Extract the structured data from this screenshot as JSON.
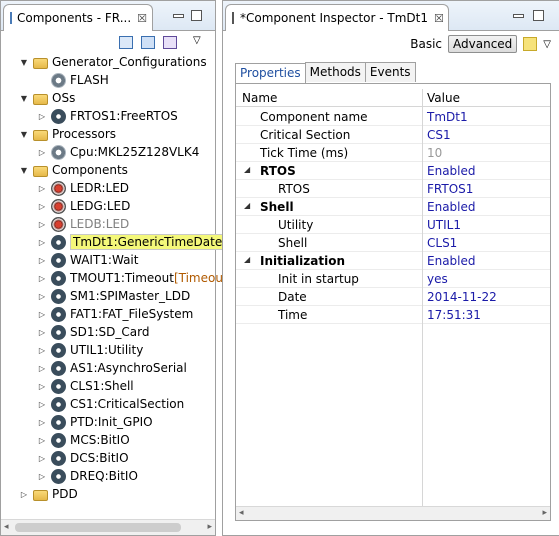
{
  "left_panel": {
    "tab_title": "Components - FR...",
    "close": "☒",
    "tree": [
      {
        "label": "Generator_Configurations",
        "indent": 0,
        "twisty": "▼",
        "icon": "folder-icon"
      },
      {
        "label": "FLASH",
        "indent": 1,
        "twisty": "",
        "icon": "gear-icon"
      },
      {
        "label": "OSs",
        "indent": 0,
        "twisty": "▼",
        "icon": "folder-icon"
      },
      {
        "label": "FRTOS1:FreeRTOS",
        "indent": 1,
        "twisty": "▷",
        "icon": "component-icon"
      },
      {
        "label": "Processors",
        "indent": 0,
        "twisty": "▼",
        "icon": "folder-icon"
      },
      {
        "label": "Cpu:MKL25Z128VLK4",
        "indent": 1,
        "twisty": "▷",
        "icon": "cpu-icon"
      },
      {
        "label": "Components",
        "indent": 0,
        "twisty": "▼",
        "icon": "folder-icon"
      },
      {
        "label": "LEDR:LED",
        "indent": 1,
        "twisty": "▷",
        "icon": "led-icon"
      },
      {
        "label": "LEDG:LED",
        "indent": 1,
        "twisty": "▷",
        "icon": "led-icon"
      },
      {
        "label": "LEDB:LED",
        "indent": 1,
        "twisty": "▷",
        "icon": "led-icon"
      },
      {
        "label": "TmDt1:GenericTimeDate",
        "indent": 1,
        "twisty": "▷",
        "icon": "component-icon",
        "selected": true
      },
      {
        "label": "WAIT1:Wait",
        "indent": 1,
        "twisty": "▷",
        "icon": "component-icon"
      },
      {
        "label": "TMOUT1:Timeout",
        "label_suffix": "[Timeou",
        "indent": 1,
        "twisty": "▷",
        "icon": "component-icon"
      },
      {
        "label": "SM1:SPIMaster_LDD",
        "indent": 1,
        "twisty": "▷",
        "icon": "component-icon"
      },
      {
        "label": "FAT1:FAT_FileSystem",
        "indent": 1,
        "twisty": "▷",
        "icon": "component-icon"
      },
      {
        "label": "SD1:SD_Card",
        "indent": 1,
        "twisty": "▷",
        "icon": "component-icon"
      },
      {
        "label": "UTIL1:Utility",
        "indent": 1,
        "twisty": "▷",
        "icon": "component-icon"
      },
      {
        "label": "AS1:AsynchroSerial",
        "indent": 1,
        "twisty": "▷",
        "icon": "component-icon"
      },
      {
        "label": "CLS1:Shell",
        "indent": 1,
        "twisty": "▷",
        "icon": "component-icon"
      },
      {
        "label": "CS1:CriticalSection",
        "indent": 1,
        "twisty": "▷",
        "icon": "component-icon"
      },
      {
        "label": "PTD:Init_GPIO",
        "indent": 1,
        "twisty": "▷",
        "icon": "component-icon"
      },
      {
        "label": "MCS:BitIO",
        "indent": 1,
        "twisty": "▷",
        "icon": "component-icon"
      },
      {
        "label": "DCS:BitIO",
        "indent": 1,
        "twisty": "▷",
        "icon": "component-icon"
      },
      {
        "label": "DREQ:BitIO",
        "indent": 1,
        "twisty": "▷",
        "icon": "component-icon"
      },
      {
        "label": "PDD",
        "indent": 0,
        "twisty": "▷",
        "icon": "folder-icon"
      }
    ]
  },
  "right_panel": {
    "tab_title": "*Component Inspector - TmDt1",
    "close": "☒",
    "basic_label": "Basic",
    "advanced_label": "Advanced",
    "tabs": [
      "Properties",
      "Methods",
      "Events"
    ],
    "columns": {
      "name": "Name",
      "value": "Value"
    },
    "rows": [
      {
        "name": "Component name",
        "value": "TmDt1",
        "level": 1
      },
      {
        "name": "Critical Section",
        "value": "CS1",
        "level": 1
      },
      {
        "name": "Tick Time (ms)",
        "value": "10",
        "level": 1,
        "disabled": true
      },
      {
        "name": "RTOS",
        "value": "Enabled",
        "level": 1,
        "group": true
      },
      {
        "name": "RTOS",
        "value": "FRTOS1",
        "level": 2
      },
      {
        "name": "Shell",
        "value": "Enabled",
        "level": 1,
        "group": true
      },
      {
        "name": "Utility",
        "value": "UTIL1",
        "level": 2
      },
      {
        "name": "Shell",
        "value": "CLS1",
        "level": 2
      },
      {
        "name": "Initialization",
        "value": "Enabled",
        "level": 1,
        "group": true
      },
      {
        "name": "Init in startup",
        "value": "yes",
        "level": 2
      },
      {
        "name": "Date",
        "value": "2014-11-22",
        "level": 2
      },
      {
        "name": "Time",
        "value": "17:51:31",
        "level": 2
      }
    ]
  },
  "colors": {
    "accent": "#1a1aa8",
    "selection": "#f4f87a",
    "tab_active_text": "#1f4fa0",
    "suffix": "#b05a00"
  }
}
